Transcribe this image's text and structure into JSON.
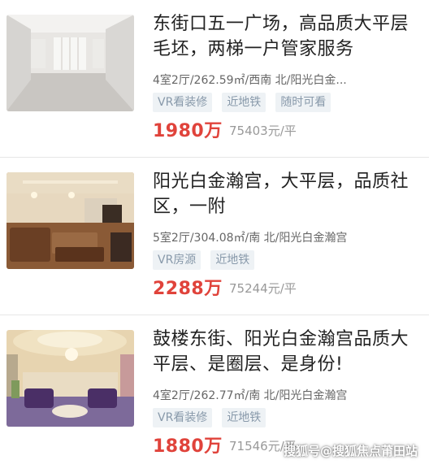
{
  "listings": [
    {
      "title": "东街口五一广场，高品质大平层毛坯，两梯一户管家服务",
      "meta": "4室2厅/262.59㎡/西南 北/阳光白金...",
      "tags": [
        "VR看装修",
        "近地铁",
        "随时可看"
      ],
      "price": "1980万",
      "unit_price": "75403元/平"
    },
    {
      "title": "阳光白金瀚宫，大平层，品质社区，一附",
      "meta": "5室2厅/304.08㎡/南 北/阳光白金瀚宫",
      "tags": [
        "VR房源",
        "近地铁"
      ],
      "price": "2288万",
      "unit_price": "75244元/平"
    },
    {
      "title": "鼓楼东街、阳光白金瀚宫品质大平层、是圈层、是身份!",
      "meta": "4室2厅/262.77㎡/南 北/阳光白金瀚宫",
      "tags": [
        "VR看装修",
        "近地铁"
      ],
      "price": "1880万",
      "unit_price": "71546元/平"
    }
  ],
  "watermark": "搜狐号@搜狐焦点莆田站",
  "colors": {
    "price": "#e0433b",
    "tag_bg": "#eef2f5",
    "tag_text": "#8899aa"
  }
}
